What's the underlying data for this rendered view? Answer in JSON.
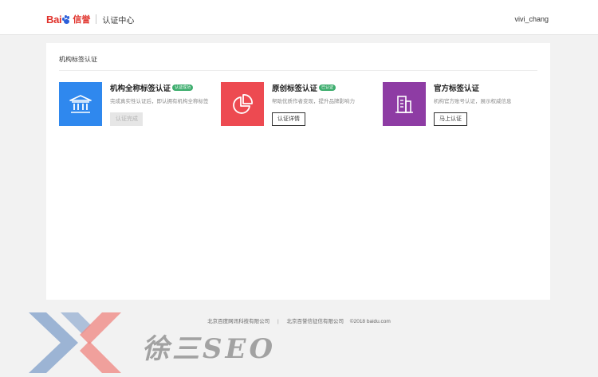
{
  "header": {
    "logo_text": "Bai",
    "logo_tag": "信誉",
    "section_title": "认证中心",
    "username": "vivi_chang"
  },
  "panel": {
    "title": "机构标签认证"
  },
  "cards": [
    {
      "title": "机构全称标签认证",
      "badge": "认证成功",
      "description": "完成真实性认证后，即认拥有机构全称标签",
      "button": "认证完成",
      "tile_color": "#2f88ee",
      "icon": "institution-icon"
    },
    {
      "title": "原创标签认证",
      "badge": "已认证",
      "description": "帮助优质作者变现，提升品牌影响力",
      "button": "认证详情",
      "tile_color": "#ed4a51",
      "icon": "pie-chart-icon"
    },
    {
      "title": "官方标签认证",
      "badge": "",
      "description": "机构官方账号认证，展示权威信息",
      "button": "马上认证",
      "tile_color": "#8e3ca4",
      "icon": "building-icon"
    }
  ],
  "footer": {
    "company_1": "北京百度网讯科技有限公司",
    "separator": "|",
    "company_2": "北京百誉信征信有限公司",
    "copyright": "©2018 baidu.com"
  },
  "watermark": {
    "text": "徐三SEO"
  },
  "colors": {
    "badge_green": "#3fae6f",
    "brand_red": "#e0322b",
    "brand_blue": "#2b5fd9"
  }
}
